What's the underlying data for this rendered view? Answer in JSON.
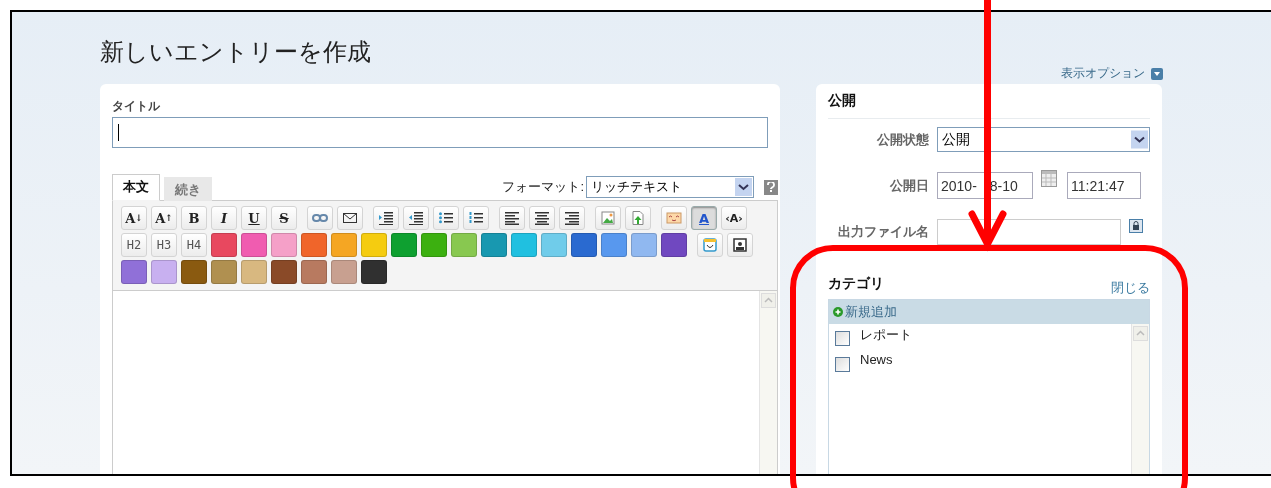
{
  "page_title": "新しいエントリーを作成",
  "view_options": {
    "label": "表示オプション"
  },
  "editor": {
    "title_label": "タイトル",
    "tabs": [
      {
        "label": "本文",
        "selected": true
      },
      {
        "label": "続き",
        "selected": false
      }
    ],
    "format_label": "フォーマット:",
    "format_value": "リッチテキスト",
    "toolbar_rows": [
      [
        [
          {
            "kind": "label-down",
            "label": "A",
            "arrow": "↓",
            "pressed": false
          },
          {
            "kind": "label-up",
            "label": "A",
            "arrow": "↑",
            "pressed": false
          },
          {
            "kind": "bold",
            "label": "B",
            "pressed": false
          },
          {
            "kind": "italic",
            "label": "I",
            "pressed": false
          },
          {
            "kind": "underline",
            "label": "U",
            "pressed": false
          },
          {
            "kind": "strike",
            "label": "S",
            "pressed": false
          }
        ],
        [
          {
            "kind": "icon",
            "pressed": false
          },
          {
            "kind": "icon",
            "pressed": false
          }
        ],
        [
          {
            "kind": "icon",
            "pressed": false
          },
          {
            "kind": "icon",
            "pressed": false
          },
          {
            "kind": "icon",
            "pressed": false
          },
          {
            "kind": "icon",
            "pressed": false
          }
        ],
        [
          {
            "kind": "icon",
            "pressed": false
          },
          {
            "kind": "icon",
            "pressed": false
          },
          {
            "kind": "icon",
            "pressed": false
          }
        ],
        [
          {
            "kind": "icon",
            "pressed": false
          },
          {
            "kind": "icon",
            "pressed": false
          }
        ],
        [
          {
            "kind": "icon",
            "pressed": false
          },
          {
            "kind": "color-letter",
            "label": "A",
            "pressed": true
          },
          {
            "kind": "tag",
            "label": "‹A›",
            "pressed": false
          }
        ]
      ],
      [
        [
          {
            "kind": "heading",
            "label": "H2",
            "pressed": false
          },
          {
            "kind": "heading",
            "label": "H3",
            "pressed": false
          },
          {
            "kind": "heading",
            "label": "H4",
            "pressed": false
          },
          {
            "kind": "swatch",
            "color": "#e8485f"
          },
          {
            "kind": "swatch",
            "color": "#f05cb0"
          },
          {
            "kind": "swatch",
            "color": "#f5a0c8"
          },
          {
            "kind": "swatch",
            "color": "#f0652a"
          },
          {
            "kind": "swatch",
            "color": "#f5a623"
          },
          {
            "kind": "swatch",
            "color": "#f5cc10"
          },
          {
            "kind": "swatch",
            "color": "#0ea030"
          },
          {
            "kind": "swatch",
            "color": "#3cb010"
          },
          {
            "kind": "swatch",
            "color": "#88c850"
          },
          {
            "kind": "swatch",
            "color": "#1898b0"
          },
          {
            "kind": "swatch",
            "color": "#20c0e0"
          },
          {
            "kind": "swatch",
            "color": "#70ccea"
          },
          {
            "kind": "swatch",
            "color": "#2a6ad0"
          },
          {
            "kind": "swatch",
            "color": "#5898ee"
          },
          {
            "kind": "swatch",
            "color": "#90b8f0"
          },
          {
            "kind": "swatch",
            "color": "#7048c0"
          }
        ],
        [
          {
            "kind": "icon",
            "pressed": false
          },
          {
            "kind": "icon",
            "pressed": false
          }
        ]
      ],
      [
        [
          {
            "kind": "swatch",
            "color": "#9070d8"
          },
          {
            "kind": "swatch",
            "color": "#c8b0f0"
          },
          {
            "kind": "swatch",
            "color": "#8a5a10"
          },
          {
            "kind": "swatch",
            "color": "#b09050"
          },
          {
            "kind": "swatch",
            "color": "#d8b880"
          },
          {
            "kind": "swatch",
            "color": "#8a4a28"
          },
          {
            "kind": "swatch",
            "color": "#b87a60"
          },
          {
            "kind": "swatch",
            "color": "#c8a090"
          },
          {
            "kind": "swatch",
            "color": "#303030"
          }
        ]
      ]
    ]
  },
  "publish": {
    "heading": "公開",
    "status": {
      "label": "公開状態",
      "value": "公開"
    },
    "date": {
      "label": "公開日",
      "date_parts": [
        "2010-",
        "8-10"
      ],
      "time": "11:21:47"
    },
    "filename": {
      "label": "出力ファイル名"
    }
  },
  "category": {
    "heading": "カテゴリ",
    "close_link": "閉じる",
    "add_new": "新規追加",
    "items": [
      {
        "label": "レポート",
        "checked": false
      },
      {
        "label": "News",
        "checked": false
      }
    ]
  }
}
